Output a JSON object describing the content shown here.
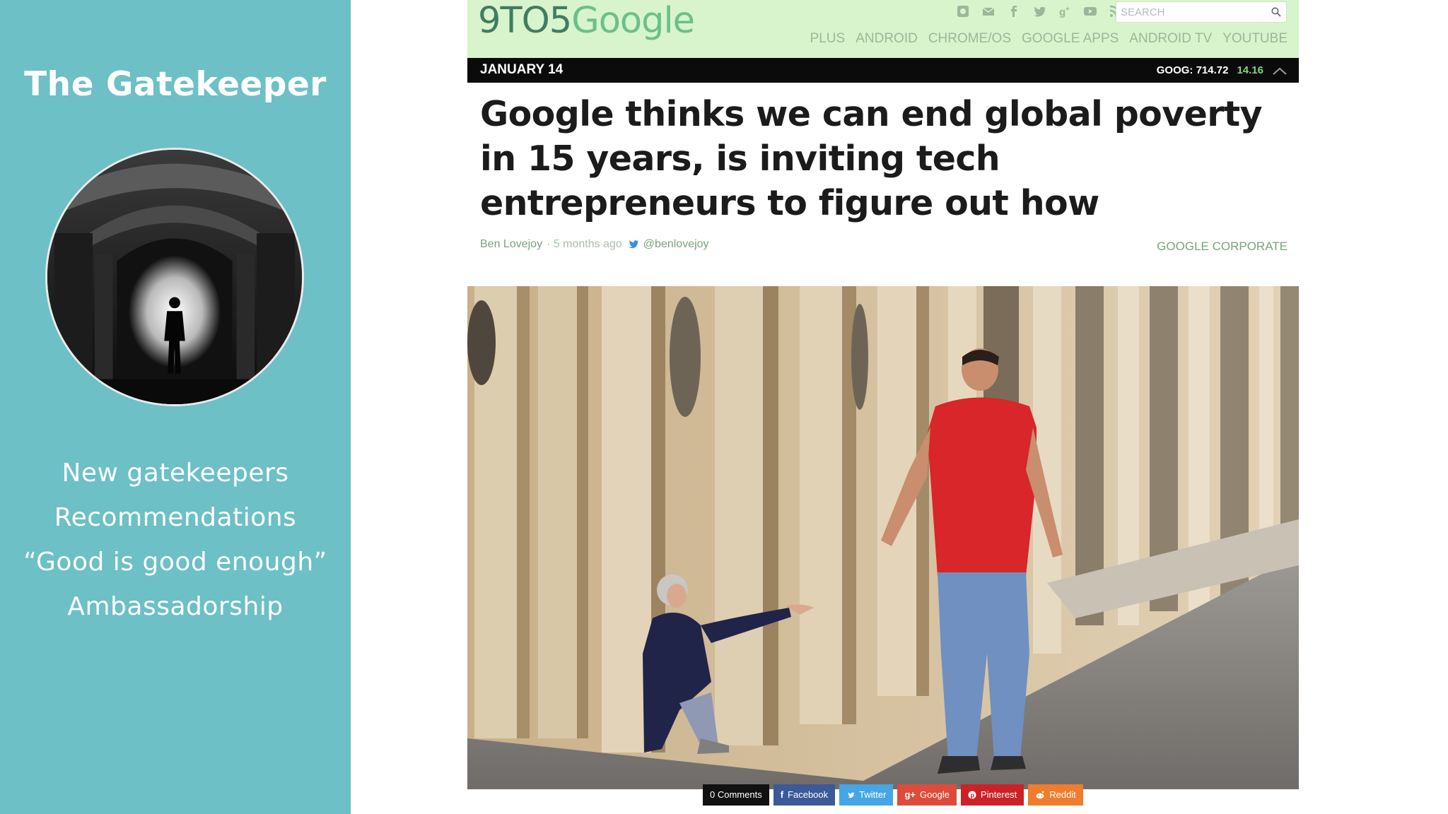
{
  "slide": {
    "title": "The Gatekeeper",
    "bullets": [
      "New gatekeepers",
      "Recommendations",
      "“Good is good enough”",
      "Ambassadorship"
    ]
  },
  "site": {
    "logo_num": "9TO5",
    "logo_word": "Google",
    "search_placeholder": "SEARCH",
    "social_icons": [
      "instagram-icon",
      "mail-icon",
      "facebook-icon",
      "twitter-icon",
      "google-plus-icon",
      "youtube-icon",
      "rss-icon"
    ],
    "nav": [
      "PLUS",
      "ANDROID",
      "CHROME/OS",
      "GOOGLE APPS",
      "ANDROID TV",
      "YOUTUBE"
    ]
  },
  "date_bar": {
    "date": "JANUARY 14",
    "ticker_label": "GOOG: 714.72",
    "ticker_change": "14.16"
  },
  "article": {
    "headline": "Google thinks we can end global poverty in 15 years, is inviting tech entrepreneurs to figure out how",
    "author": "Ben Lovejoy",
    "time_ago": "· 5 months ago",
    "handle": "@benlovejoy",
    "category": "GOOGLE CORPORATE"
  },
  "share": {
    "comments": "0 Comments",
    "facebook": "Facebook",
    "twitter": "Twitter",
    "google": "Google",
    "pinterest": "Pinterest",
    "reddit": "Reddit"
  },
  "colors": {
    "slide_panel": "#6cc0c6",
    "header_bg": "#d8f4cc",
    "accent_green": "#79a37b",
    "shirt_red": "#d8262a"
  }
}
